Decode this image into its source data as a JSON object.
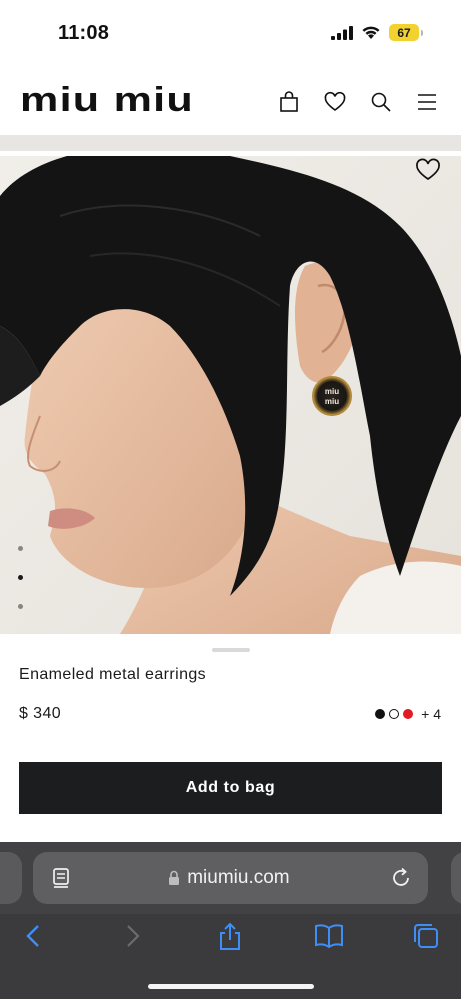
{
  "status_bar": {
    "time": "11:08",
    "battery": "67"
  },
  "header": {
    "brand": "miu miu",
    "icons": [
      "bag-icon",
      "heart-icon",
      "search-icon",
      "menu-icon"
    ]
  },
  "product": {
    "title": "Enameled metal earrings",
    "price": "$ 340",
    "image_count": 3,
    "active_image_index": 1,
    "swatches": [
      {
        "color": "#111111",
        "name": "black"
      },
      {
        "color": "#ffffff",
        "name": "white"
      },
      {
        "color": "#e11b22",
        "name": "red"
      }
    ],
    "swatch_more": "+ 4",
    "cta": "Add to bag"
  },
  "browser": {
    "url": "miumiu.com",
    "accent": "#3e8ef7",
    "toolbar_icons": [
      "back-icon",
      "forward-icon",
      "share-icon",
      "bookmarks-icon",
      "tabs-icon"
    ]
  }
}
